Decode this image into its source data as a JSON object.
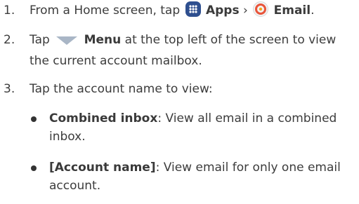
{
  "steps": [
    {
      "num": "1.",
      "pre": "From a Home screen, tap",
      "apps_label": "Apps",
      "sep": "›",
      "email_label": "Email",
      "post": "."
    },
    {
      "num": "2.",
      "pre": "Tap",
      "menu_label": "Menu",
      "post": "at the top left of the screen to view the current account mailbox."
    },
    {
      "num": "3.",
      "text": "Tap the account name to view:"
    }
  ],
  "bullets": [
    {
      "term": "Combined inbox",
      "desc": ": View all email in a combined inbox."
    },
    {
      "term": "[Account name]",
      "desc": ": View email for only one email account."
    }
  ],
  "icons": {
    "apps": "apps-grid-icon",
    "email": "email-app-icon",
    "menu": "menu-triangle-icon"
  },
  "colors": {
    "apps_icon": "#2e4f8f",
    "email_icon_ring": "#e8543a",
    "menu_icon": "#a9b6c6"
  }
}
